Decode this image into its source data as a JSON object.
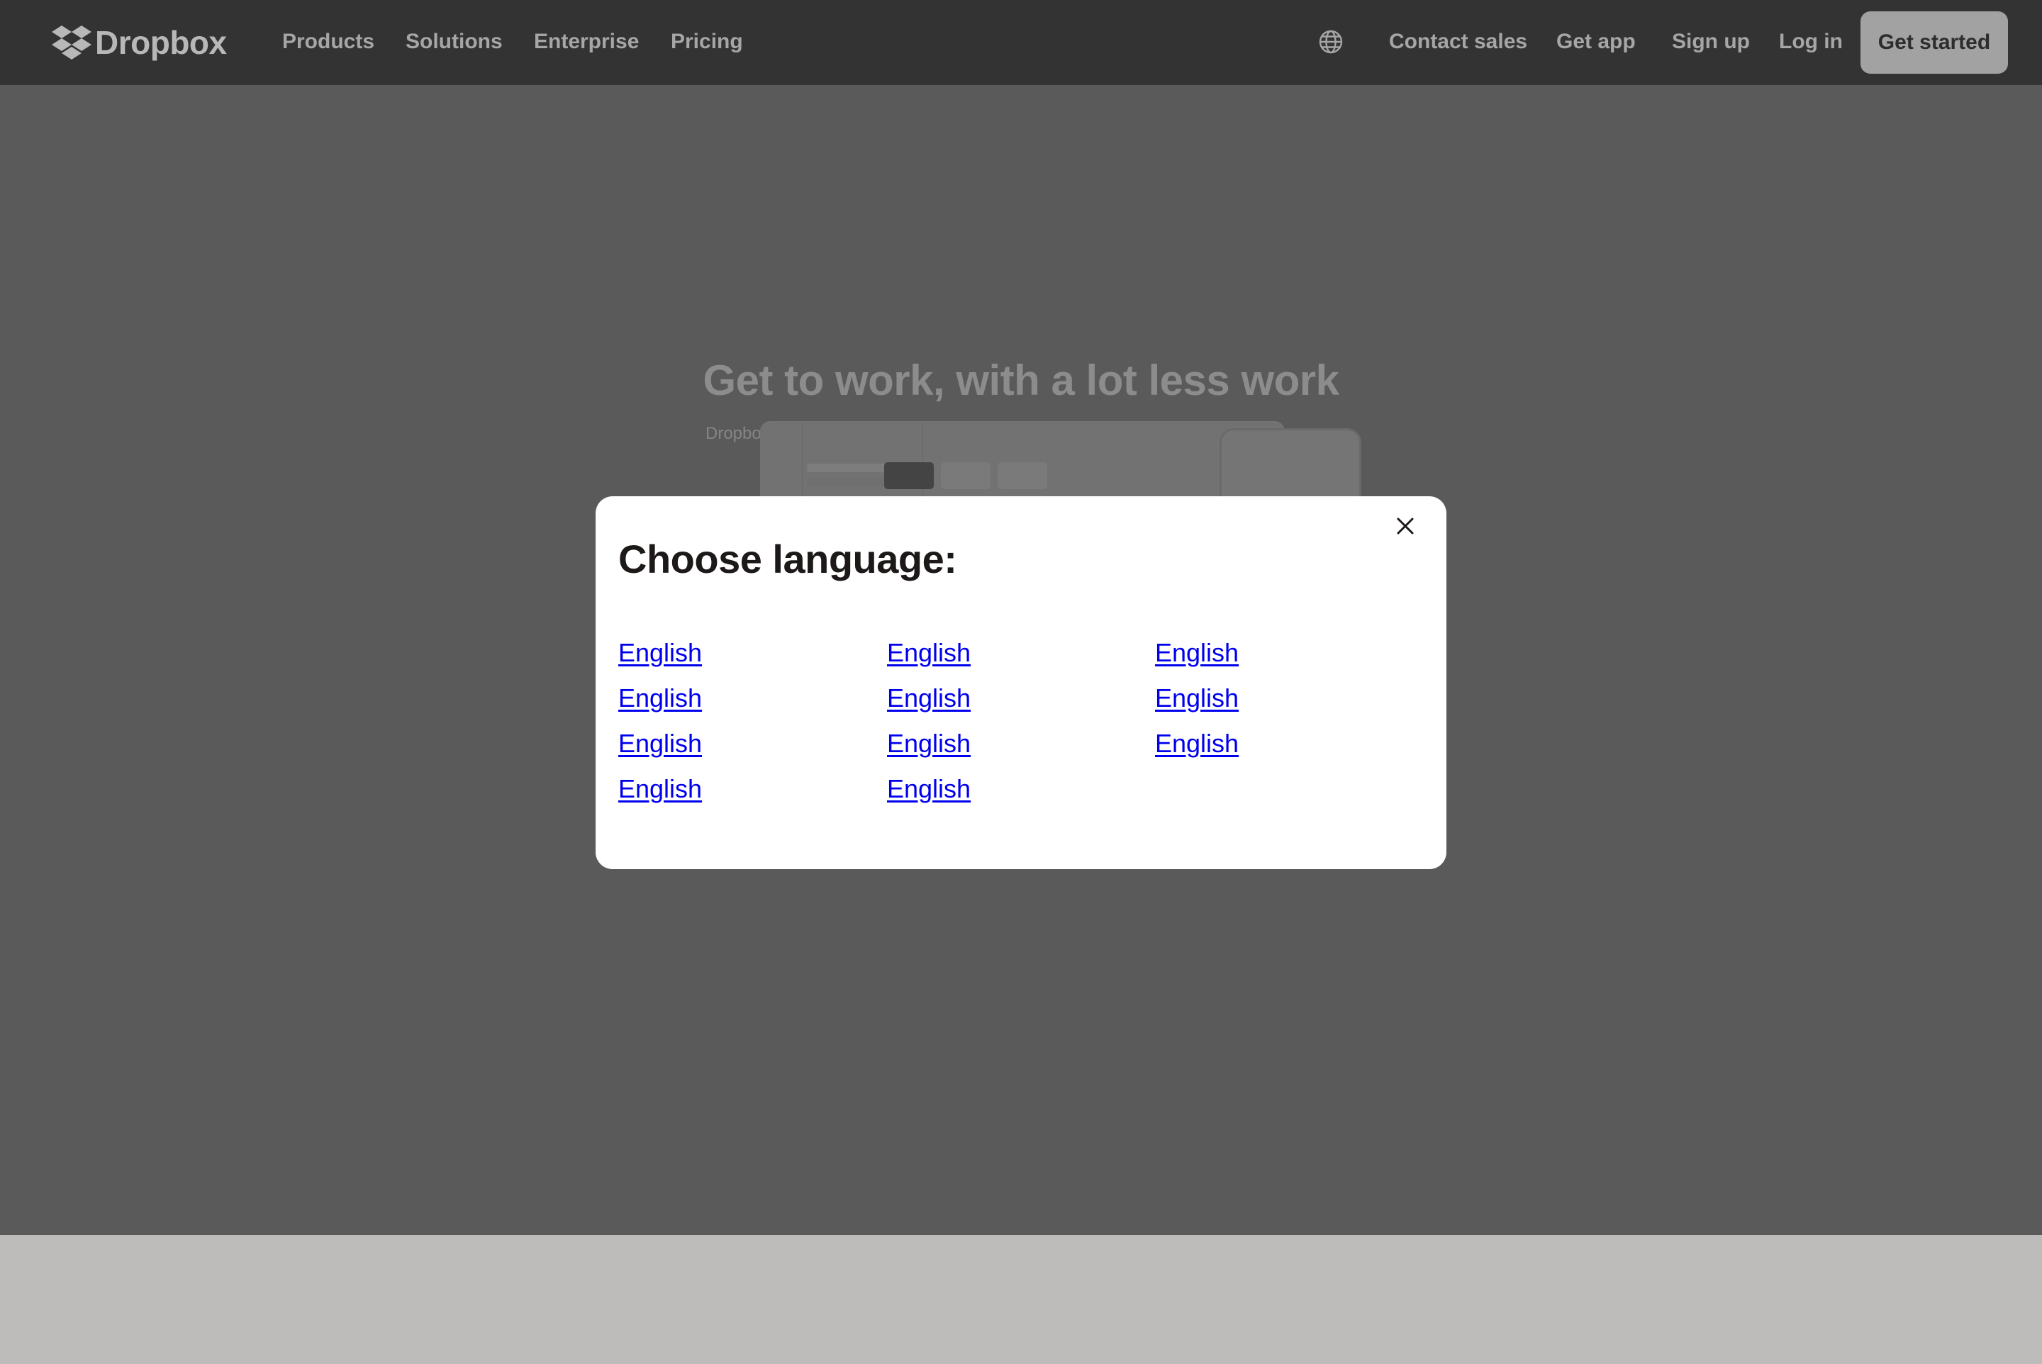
{
  "header": {
    "brand": "Dropbox",
    "nav": [
      "Products",
      "Solutions",
      "Enterprise",
      "Pricing"
    ],
    "right": {
      "language_icon": "globe-icon",
      "contact_sales": "Contact sales",
      "get_app": "Get app",
      "sign_up": "Sign up",
      "log_in": "Log in",
      "get_started": "Get started"
    }
  },
  "hero": {
    "title": "Get to work, with a lot less work",
    "subtitle_fragment": "Dropbo"
  },
  "modal": {
    "title": "Choose language:",
    "close_icon": "close-icon",
    "languages": [
      [
        "English",
        "English",
        "English"
      ],
      [
        "English",
        "English",
        "English"
      ],
      [
        "English",
        "English",
        "English"
      ],
      [
        "English",
        "English"
      ]
    ]
  },
  "colors": {
    "header_bg": "#333333",
    "overlay_bg": "#5a5a5a",
    "modal_bg": "#ffffff",
    "link": "#0000ee",
    "cta_bg": "#a2a2a2"
  }
}
